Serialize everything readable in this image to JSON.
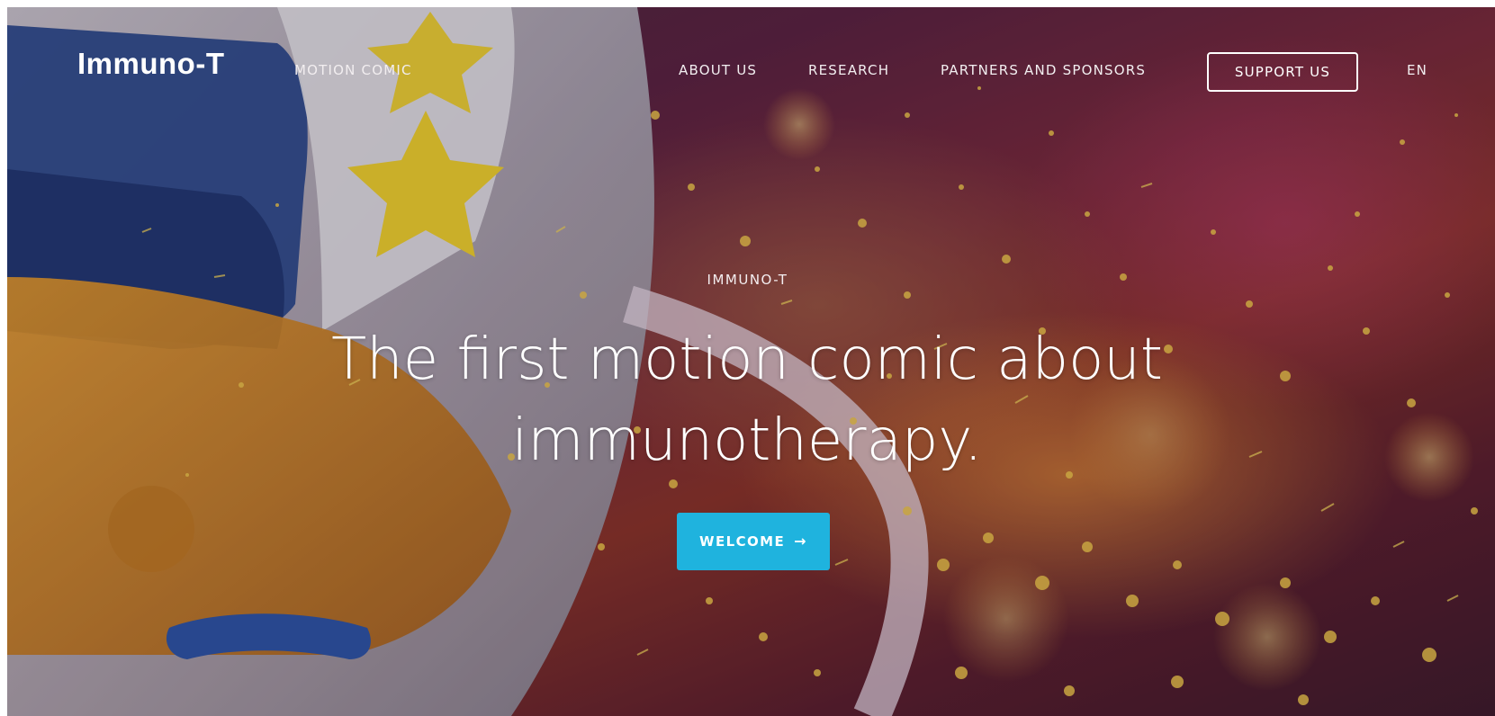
{
  "header": {
    "logo": "Immuno-T",
    "nav": {
      "motion_comic": "MOTION COMIC",
      "about_us": "ABOUT US",
      "research": "RESEARCH",
      "partners": "PARTNERS AND SPONSORS",
      "support": "SUPPORT US",
      "language": "EN"
    }
  },
  "hero": {
    "eyebrow": "IMMUNO-T",
    "headline_line1": "The first motion comic about",
    "headline_line2": "immunotherapy.",
    "cta_label": "WELCOME",
    "cta_icon": "arrow-right-icon",
    "cta_icon_glyph": "→",
    "background_image": "helmet-character-with-golden-particles",
    "accent_color": "#1fb3de"
  }
}
